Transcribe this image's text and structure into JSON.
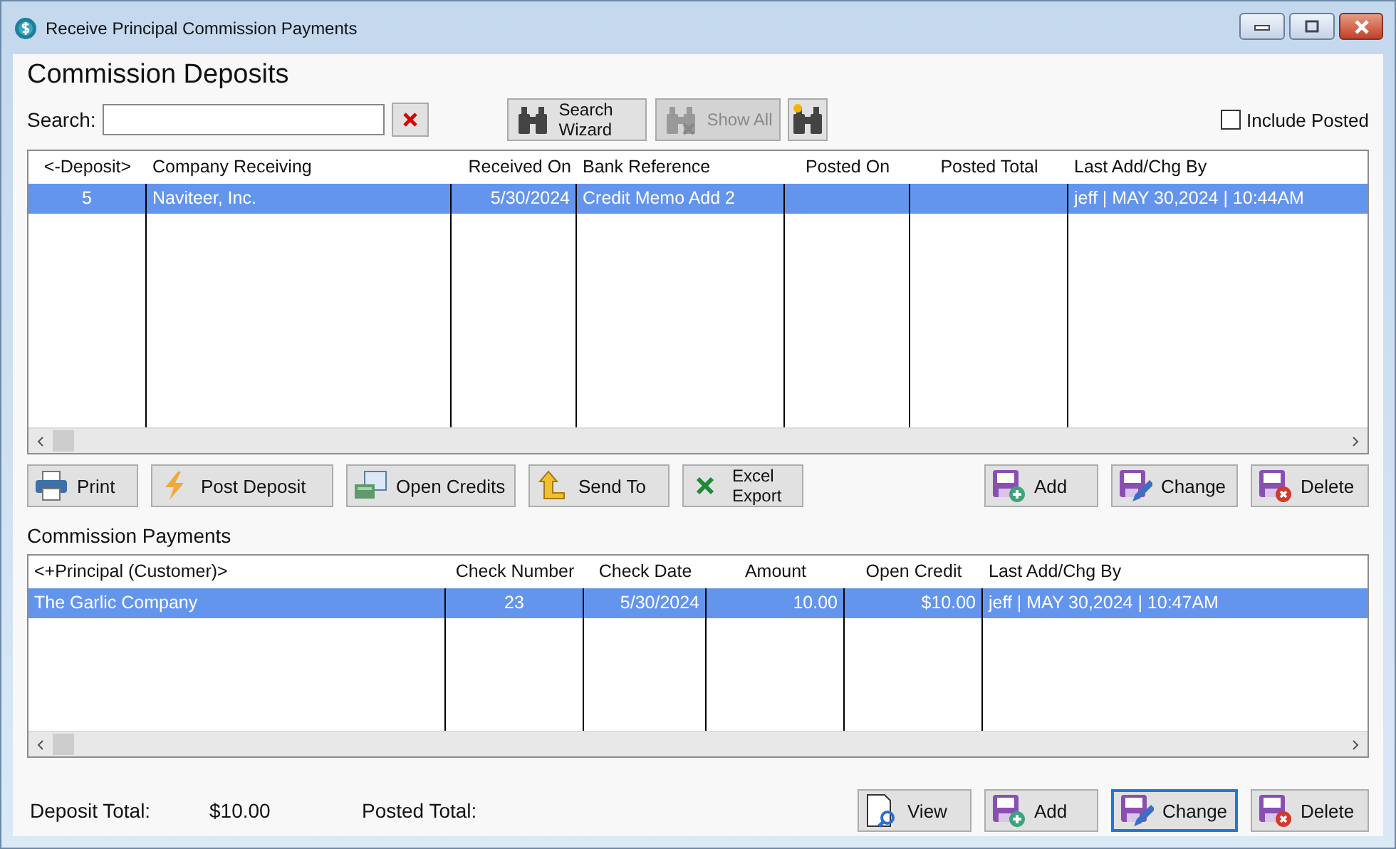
{
  "window": {
    "title": "Receive Principal Commission Payments"
  },
  "heading": "Commission Deposits",
  "search": {
    "label": "Search:"
  },
  "toolbar": [
    {
      "kind": "wizard",
      "label": "Search Wizard",
      "disabled": false
    },
    {
      "kind": "showall",
      "label": "Show All",
      "disabled": true
    },
    {
      "kind": "new",
      "disabled": false
    }
  ],
  "include_posted": {
    "label": "Include Posted",
    "checked": false
  },
  "deposits": {
    "columns": [
      "<-Deposit>",
      "Company Receiving",
      "Received On",
      "Bank Reference",
      "Posted On",
      "Posted Total",
      "Last Add/Chg By"
    ],
    "rows": [
      {
        "selected": true,
        "cells": [
          "5",
          "Naviteer, Inc.",
          "5/30/2024",
          "Credit Memo Add 2",
          "",
          "",
          "jeff | MAY 30,2024 | 10:44AM"
        ]
      }
    ]
  },
  "deposit_actions": [
    {
      "kind": "print",
      "label": "Print"
    },
    {
      "kind": "post",
      "label": "Post Deposit"
    },
    {
      "kind": "credits",
      "label": "Open Credits"
    },
    {
      "kind": "send",
      "label": "Send To"
    },
    {
      "kind": "excel",
      "label": "Excel Export"
    }
  ],
  "deposit_edit": [
    {
      "kind": "add",
      "label": "Add",
      "focused": false
    },
    {
      "kind": "change",
      "label": "Change",
      "focused": false
    },
    {
      "kind": "delete",
      "label": "Delete",
      "focused": false
    }
  ],
  "payments_heading": "Commission Payments",
  "payments": {
    "columns": [
      "<+Principal (Customer)>",
      "Check Number",
      "Check Date",
      "Amount",
      "Open Credit",
      "Last Add/Chg By"
    ],
    "rows": [
      {
        "selected": true,
        "cells": [
          "The Garlic Company",
          "23",
          "5/30/2024",
          "10.00",
          "$10.00",
          "jeff | MAY 30,2024 | 10:47AM"
        ]
      }
    ]
  },
  "footer": {
    "deposit_total_label": "Deposit Total:",
    "deposit_total": "$10.00",
    "posted_total_label": "Posted Total:"
  },
  "payment_edit": [
    {
      "kind": "view",
      "label": "View",
      "focused": false
    },
    {
      "kind": "add",
      "label": "Add",
      "focused": false
    },
    {
      "kind": "change",
      "label": "Change",
      "focused": true
    },
    {
      "kind": "delete",
      "label": "Delete",
      "focused": false
    }
  ]
}
